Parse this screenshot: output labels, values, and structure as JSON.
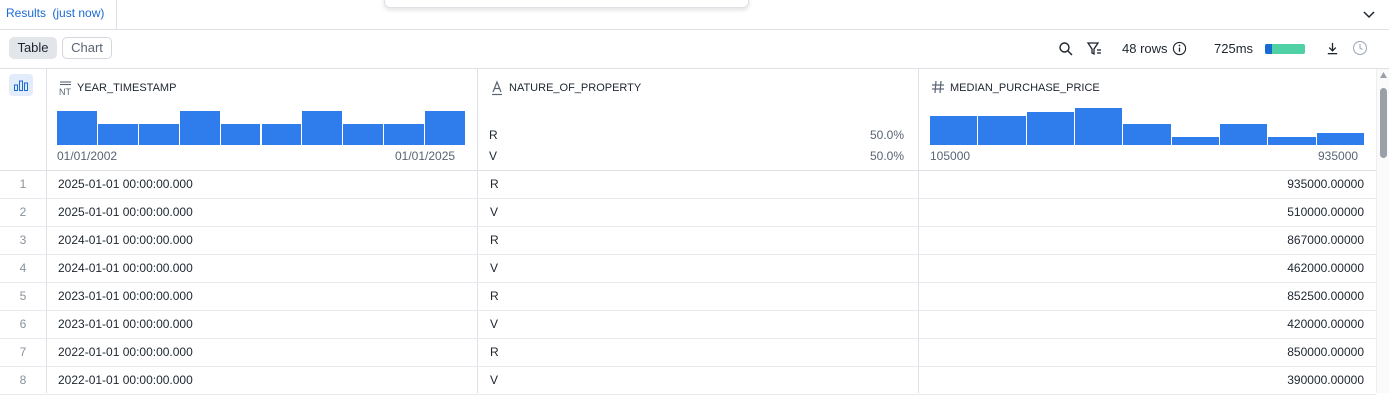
{
  "tab": {
    "title": "Results",
    "subtitle": "(just now)"
  },
  "toolbar": {
    "view_table": "Table",
    "view_chart": "Chart",
    "rows": "48 rows",
    "duration": "725ms",
    "duration_progress": 0.18
  },
  "columns": [
    {
      "name": "YEAR_TIMESTAMP",
      "type_icon": "timestamp-ntz-icon",
      "hist": [
        0.92,
        0.56,
        0.56,
        0.92,
        0.56,
        0.56,
        0.92,
        0.56,
        0.56,
        0.92
      ],
      "min": "01/01/2002",
      "max": "01/01/2025"
    },
    {
      "name": "NATURE_OF_PROPERTY",
      "type_icon": "text-type-icon",
      "values": [
        {
          "label": "R",
          "pct": "50.0%"
        },
        {
          "label": "V",
          "pct": "50.0%"
        }
      ]
    },
    {
      "name": "MEDIAN_PURCHASE_PRICE",
      "type_icon": "hash-icon",
      "hist": [
        0.78,
        0.78,
        0.89,
        1.0,
        0.56,
        0.22,
        0.56,
        0.22,
        0.33
      ],
      "min": "105000",
      "max": "935000"
    }
  ],
  "rows": [
    {
      "n": "1",
      "year": "2025-01-01 00:00:00.000",
      "nature": "R",
      "price": "935000.00000"
    },
    {
      "n": "2",
      "year": "2025-01-01 00:00:00.000",
      "nature": "V",
      "price": "510000.00000"
    },
    {
      "n": "3",
      "year": "2024-01-01 00:00:00.000",
      "nature": "R",
      "price": "867000.00000"
    },
    {
      "n": "4",
      "year": "2024-01-01 00:00:00.000",
      "nature": "V",
      "price": "462000.00000"
    },
    {
      "n": "5",
      "year": "2023-01-01 00:00:00.000",
      "nature": "R",
      "price": "852500.00000"
    },
    {
      "n": "6",
      "year": "2023-01-01 00:00:00.000",
      "nature": "V",
      "price": "420000.00000"
    },
    {
      "n": "7",
      "year": "2022-01-01 00:00:00.000",
      "nature": "R",
      "price": "850000.00000"
    },
    {
      "n": "8",
      "year": "2022-01-01 00:00:00.000",
      "nature": "V",
      "price": "390000.00000"
    }
  ],
  "colors": {
    "accent": "#1a6ad3",
    "bar": "#2f7ded",
    "progress_bg": "#4fd1a5"
  }
}
